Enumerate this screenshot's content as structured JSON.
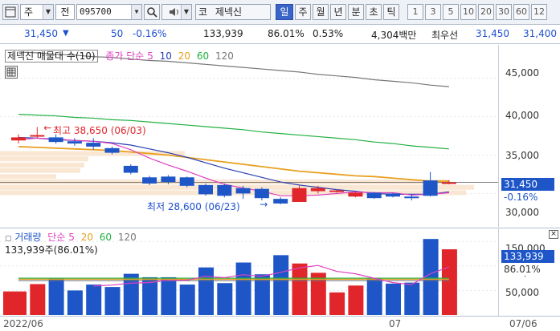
{
  "toolbar": {
    "market": "주",
    "type_label": "전",
    "code": "095700",
    "exchange_label": "코",
    "stock_name": "제넥신",
    "periods": [
      "일",
      "주",
      "월",
      "년",
      "분",
      "초",
      "틱"
    ],
    "selected_period": "일",
    "intervals": [
      "1",
      "3",
      "5",
      "10",
      "20",
      "30",
      "60",
      "12"
    ]
  },
  "quote": {
    "price": "31,450",
    "change": "50",
    "change_pct": "-0.16%",
    "volume": "133,939",
    "volume_ratio": "86.01%",
    "turnover_pct": "0.53%",
    "amount": "4,304백만",
    "label_best": "최우선",
    "ask": "31,450",
    "bid": "31,400"
  },
  "price_pane": {
    "legend_title": "제넥신 매물대 수(10)",
    "legend_ma": "종가 단순",
    "ma_periods": [
      "5",
      "10",
      "20",
      "60",
      "120"
    ],
    "y_ticks": [
      "45,000",
      "40,000",
      "35,000",
      "30,000"
    ],
    "current_price_tag": "31,450",
    "current_change_tag": "-0.16%",
    "high_label": "최고 38,650 (06/03)",
    "low_label": "최저 28,600 (06/23)"
  },
  "volume_pane": {
    "legend_title": "거래량",
    "legend_ma": "단순",
    "ma_periods": [
      "5",
      "20",
      "60",
      "120"
    ],
    "info": "133,939주(86.01%)",
    "y_ticks": [
      "150,000",
      "100,000",
      "50,000"
    ],
    "volume_tag": "133,939",
    "ratio_tag": "86.01%"
  },
  "x_axis": {
    "labels": [
      "2022/06",
      "07",
      "07/06"
    ]
  },
  "colors": {
    "up": "#e0262a",
    "down": "#1e56c8",
    "ma5": "#e040c0",
    "ma10": "#2a3fb0",
    "ma20": "#e8a020",
    "ma60": "#20b040",
    "ma120": "#777777"
  },
  "chart_data": {
    "type": "candlestick",
    "x": [
      "06/02",
      "06/03",
      "06/07",
      "06/08",
      "06/09",
      "06/10",
      "06/13",
      "06/14",
      "06/15",
      "06/16",
      "06/17",
      "06/20",
      "06/21",
      "06/22",
      "06/23",
      "06/24",
      "06/27",
      "06/28",
      "06/29",
      "06/30",
      "07/01",
      "07/04",
      "07/05",
      "07/06"
    ],
    "open": [
      36900,
      37600,
      37300,
      36800,
      36600,
      35900,
      33600,
      32100,
      32200,
      32100,
      31100,
      31100,
      30700,
      30600,
      29300,
      28900,
      30300,
      30200,
      29600,
      30100,
      30000,
      29600,
      31700,
      31450
    ],
    "close": [
      37300,
      37600,
      36700,
      36500,
      36100,
      35300,
      32700,
      31300,
      31500,
      31000,
      29900,
      29700,
      30000,
      29400,
      28700,
      30700,
      30700,
      30400,
      30100,
      29400,
      29600,
      29400,
      29700,
      31450
    ],
    "high": [
      37700,
      38650,
      37700,
      37200,
      37200,
      36100,
      33800,
      32300,
      32400,
      32200,
      31300,
      31300,
      31000,
      30800,
      29500,
      31000,
      31000,
      30500,
      30200,
      30200,
      30100,
      29900,
      32800,
      31700
    ],
    "low": [
      36500,
      37200,
      36500,
      36200,
      35700,
      35100,
      32500,
      31100,
      31200,
      30800,
      29700,
      29500,
      29300,
      29100,
      28600,
      28900,
      30000,
      30100,
      29500,
      29300,
      29500,
      29100,
      29600,
      31200
    ],
    "volume": [
      48000,
      63000,
      74000,
      50000,
      62000,
      57000,
      84000,
      77000,
      77000,
      62000,
      97000,
      65000,
      107000,
      83000,
      122000,
      105000,
      86000,
      46000,
      60000,
      74000,
      64000,
      66000,
      155000,
      133939
    ],
    "ylim": [
      26500,
      48500
    ],
    "volume_ylim": [
      0,
      170000
    ],
    "volume_ma5": [
      null,
      null,
      null,
      null,
      59000,
      61000,
      65000,
      66000,
      71000,
      71000,
      79000,
      76000,
      82000,
      79000,
      87000,
      96000,
      101000,
      89000,
      84000,
      75000,
      66000,
      62000,
      84000,
      98000
    ],
    "volume_ma20_level": 73000,
    "volume_ma60_level": 75000,
    "volume_ma120_level": 70000,
    "ma5": [
      37000,
      37200,
      37100,
      36900,
      36800,
      36500,
      35700,
      34600,
      33700,
      32900,
      32000,
      31200,
      30700,
      30300,
      29700,
      29700,
      29800,
      30000,
      30200,
      30100,
      30100,
      29800,
      29900,
      30100
    ],
    "ma10": [
      37300,
      37200,
      37000,
      36900,
      36800,
      36600,
      36300,
      35800,
      35300,
      34700,
      34000,
      33300,
      32700,
      32100,
      31500,
      31100,
      30800,
      30500,
      30300,
      30000,
      29900,
      29900,
      29900,
      30200
    ],
    "ma20": [
      36100,
      36000,
      35900,
      35800,
      35700,
      35600,
      35400,
      35200,
      35000,
      34700,
      34400,
      34100,
      33800,
      33500,
      33200,
      32900,
      32700,
      32500,
      32300,
      32200,
      32000,
      31800,
      31600,
      31600
    ],
    "ma60": [
      40300,
      40200,
      40100,
      39900,
      39800,
      39600,
      39500,
      39300,
      39100,
      38900,
      38700,
      38500,
      38300,
      38000,
      37800,
      37600,
      37400,
      37200,
      37000,
      36700,
      36500,
      36200,
      36000,
      35800
    ],
    "ma120": [
      48400,
      48300,
      48100,
      48000,
      47800,
      47700,
      47500,
      47300,
      47200,
      47000,
      46800,
      46600,
      46400,
      46200,
      46000,
      45800,
      45500,
      45300,
      45100,
      44800,
      44600,
      44400,
      44100,
      43900
    ]
  }
}
